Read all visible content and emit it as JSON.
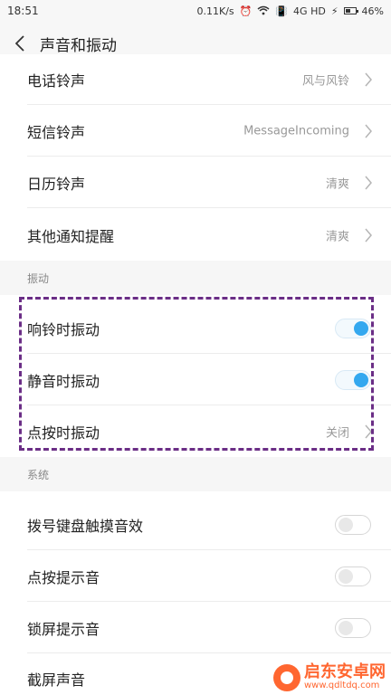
{
  "status_bar": {
    "time": "18:51",
    "speed": "0.11K/s",
    "network": "4G HD",
    "battery": "46%",
    "battery_level": 0.46
  },
  "header": {
    "title": "声音和振动"
  },
  "ringtones": [
    {
      "label": "电话铃声",
      "value": "风与风铃"
    },
    {
      "label": "短信铃声",
      "value": "MessageIncoming"
    },
    {
      "label": "日历铃声",
      "value": "清爽"
    },
    {
      "label": "其他通知提醒",
      "value": "清爽"
    }
  ],
  "vibration": {
    "heading": "振动",
    "ring_label": "响铃时振动",
    "ring_on": true,
    "silent_label": "静音时振动",
    "silent_on": true,
    "tap_label": "点按时振动",
    "tap_value": "关闭"
  },
  "system": {
    "heading": "系统",
    "items": [
      {
        "label": "拨号键盘触摸音效",
        "on": false
      },
      {
        "label": "点按提示音",
        "on": false
      },
      {
        "label": "锁屏提示音",
        "on": false
      },
      {
        "label": "截屏声音",
        "on": false
      }
    ]
  },
  "watermark": {
    "name": "启东安卓网",
    "url": "www.qdltdq.com"
  },
  "colors": {
    "accent": "#34a8ef",
    "highlight": "#6b2e86",
    "watermark": "#ff5a1f"
  }
}
